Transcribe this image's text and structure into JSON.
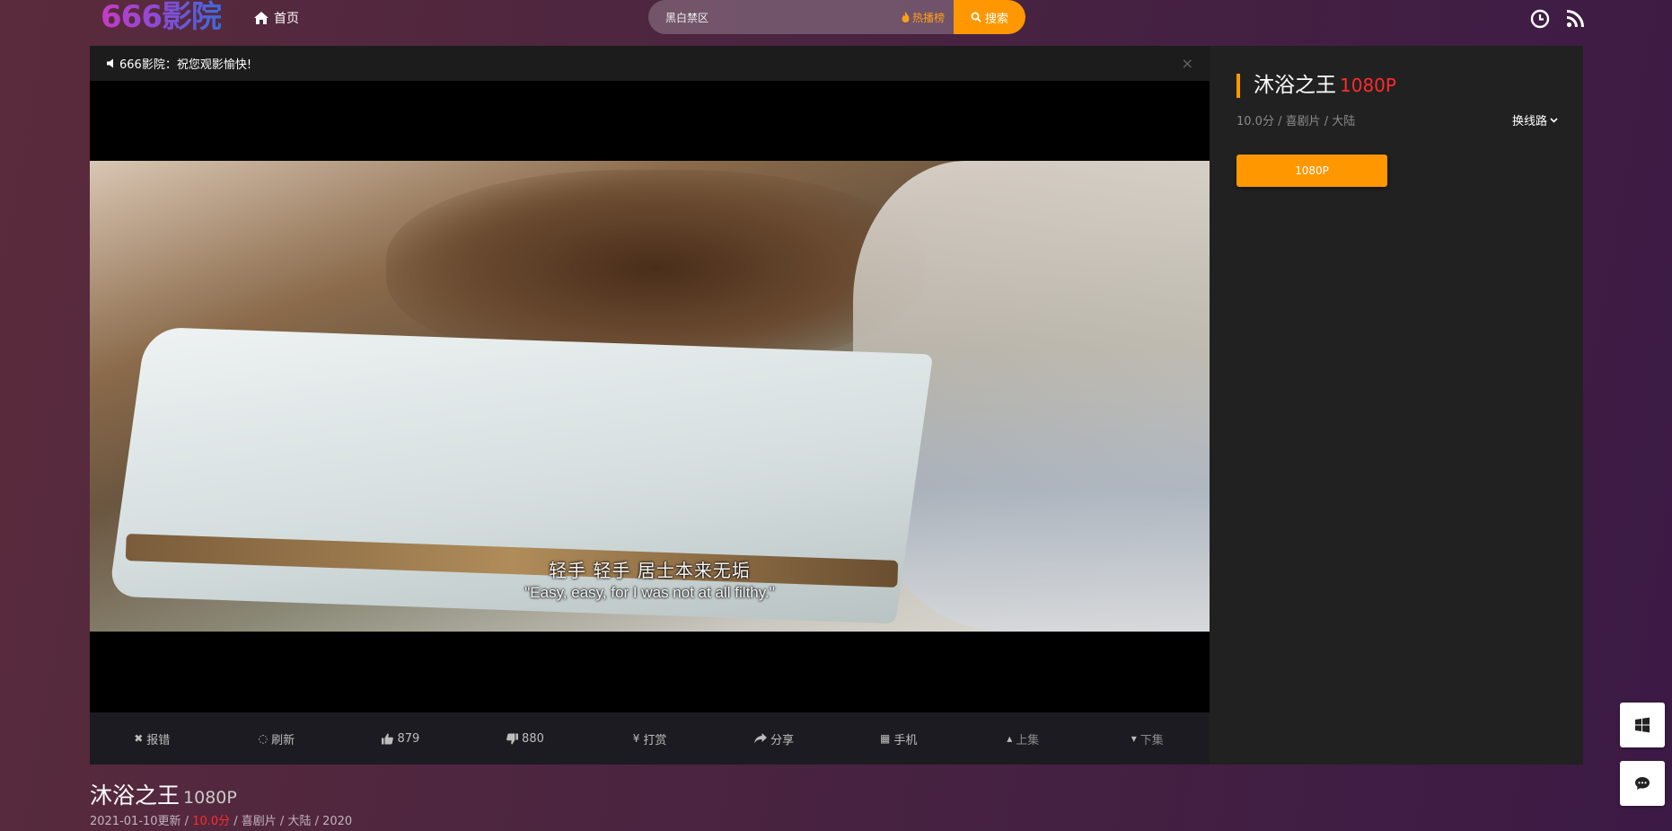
{
  "header": {
    "logo": "666影院",
    "home_label": "首页",
    "search_value": "黑白禁区",
    "hot_label": "热播榜",
    "search_button": "搜索"
  },
  "notice": {
    "text": "666影院：祝您观影愉快!",
    "close": "×"
  },
  "video": {
    "subtitle_cn": "轻手 轻手 居士本来无垢",
    "subtitle_en": "\"Easy, easy, for I was not at all filthy.\"",
    "collapse": "›"
  },
  "toolbar": {
    "report": "报错",
    "refresh": "刷新",
    "likes": "879",
    "dislikes": "880",
    "reward": "打赏",
    "share": "分享",
    "mobile": "手机",
    "prev": "上集",
    "next": "下集",
    "icons": {
      "report": "✖",
      "refresh": "◌",
      "reward": "¥",
      "mobile": "▦",
      "prev": "▴",
      "next": "▾"
    }
  },
  "sidebar": {
    "title": "沐浴之王",
    "quality": "1080P",
    "meta": "10.0分 / 喜剧片 / 大陆",
    "switch_label": "换线路",
    "episodes": [
      "1080P"
    ]
  },
  "info": {
    "title": "沐浴之王",
    "quality": "1080P",
    "updated": "2021-01-10更新 / ",
    "score": "10.0分",
    "rest": " / 喜剧片 / 大陆 / 2020"
  },
  "colors": {
    "accent": "#ff9800",
    "highlight": "#ff2b2b"
  }
}
